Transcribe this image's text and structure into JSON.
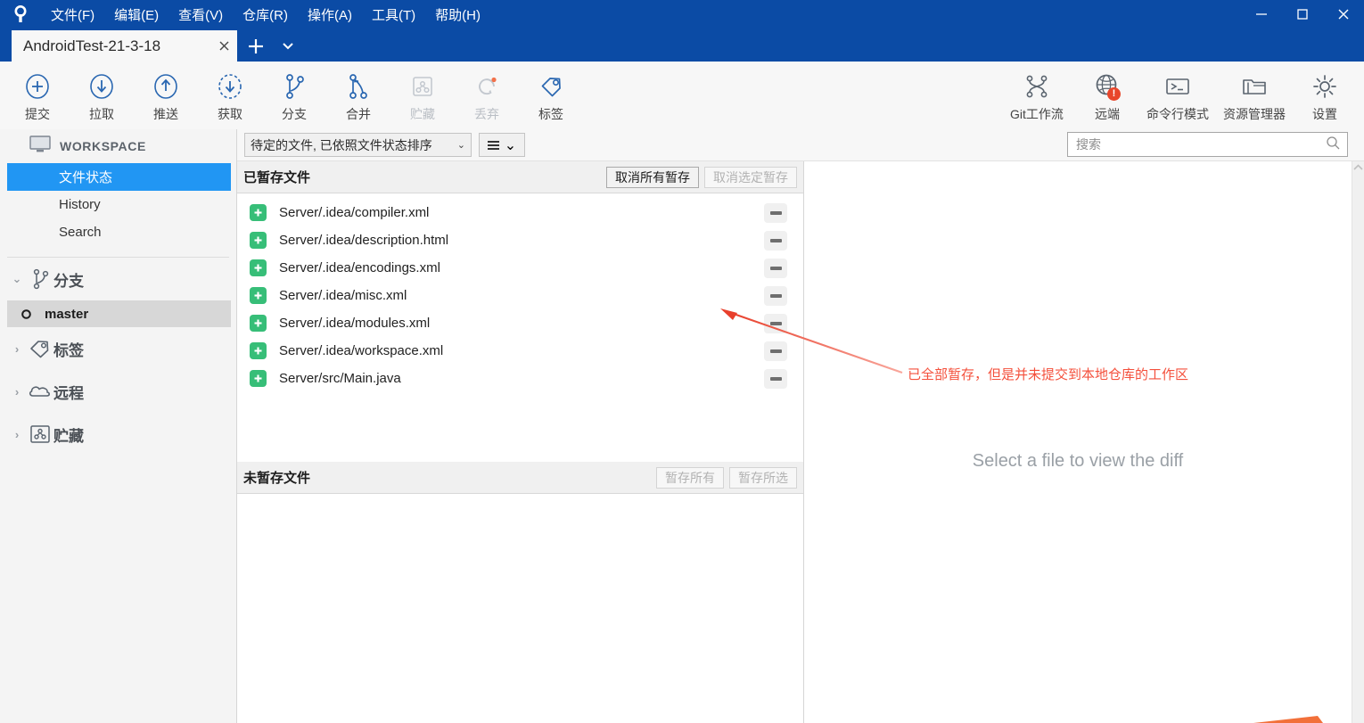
{
  "window": {
    "logo_icon": "sourcetree-logo-icon",
    "menus": [
      {
        "label": "文件(F)",
        "mnemonic": "F"
      },
      {
        "label": "编辑(E)",
        "mnemonic": "E"
      },
      {
        "label": "查看(V)",
        "mnemonic": "V"
      },
      {
        "label": "仓库(R)",
        "mnemonic": "R"
      },
      {
        "label": "操作(A)",
        "mnemonic": "A"
      },
      {
        "label": "工具(T)",
        "mnemonic": "T"
      },
      {
        "label": "帮助(H)",
        "mnemonic": "H"
      }
    ],
    "controls": {
      "minimize": "–",
      "maximize": "❐",
      "close": "✕"
    },
    "titlebar_color": "#0b4ba5"
  },
  "tabs": {
    "active": "AndroidTest-21-3-18",
    "close_label": "✕",
    "new_tab_label": "+",
    "dropdown_label": "▾",
    "menu_icon": "hamburger-menu-icon"
  },
  "toolbar": {
    "left": [
      {
        "label": "提交",
        "icon": "commit-icon",
        "disabled": false
      },
      {
        "label": "拉取",
        "icon": "pull-icon",
        "disabled": false
      },
      {
        "label": "推送",
        "icon": "push-icon",
        "disabled": false
      },
      {
        "label": "获取",
        "icon": "fetch-icon",
        "disabled": false
      },
      {
        "label": "分支",
        "icon": "branch-icon",
        "disabled": false
      },
      {
        "label": "合并",
        "icon": "merge-icon",
        "disabled": false
      },
      {
        "label": "贮藏",
        "icon": "stash-icon",
        "disabled": true
      },
      {
        "label": "丢弃",
        "icon": "discard-icon",
        "disabled": true
      },
      {
        "label": "标签",
        "icon": "tag-icon",
        "disabled": false
      }
    ],
    "right": [
      {
        "label": "Git工作流",
        "icon": "gitflow-icon",
        "badge": ""
      },
      {
        "label": "远端",
        "icon": "remote-globe-icon",
        "badge": "!"
      },
      {
        "label": "命令行模式",
        "icon": "terminal-icon",
        "badge": ""
      },
      {
        "label": "资源管理器",
        "icon": "explorer-folder-icon",
        "badge": ""
      },
      {
        "label": "设置",
        "icon": "settings-gear-icon",
        "badge": ""
      }
    ]
  },
  "sidebar": {
    "workspace_label": "WORKSPACE",
    "workspace_icon": "monitor-icon",
    "nav": [
      {
        "label": "文件状态",
        "selected": true
      },
      {
        "label": "History",
        "selected": false
      },
      {
        "label": "Search",
        "selected": false
      }
    ],
    "sections": [
      {
        "label": "分支",
        "icon": "branch-icon",
        "expanded": true,
        "chevron": "⌄"
      },
      {
        "label": "标签",
        "icon": "tag-icon",
        "expanded": false,
        "chevron": "›"
      },
      {
        "label": "远程",
        "icon": "cloud-icon",
        "expanded": false,
        "chevron": "›"
      },
      {
        "label": "贮藏",
        "icon": "stash-icon",
        "expanded": false,
        "chevron": "›"
      }
    ],
    "current_branch": "master",
    "branch_icon": "branch-dot-icon",
    "selected_color": "#2196f3"
  },
  "filterbar": {
    "sort_label": "待定的文件, 已依照文件状态排序",
    "sort_chevron": "⌄",
    "view_icon": "list-view-icon",
    "view_chevron": "⌄",
    "search_placeholder": "搜索",
    "search_value": "",
    "search_icon": "search-icon"
  },
  "staged": {
    "title": "已暂存文件",
    "buttons": [
      {
        "label": "取消所有暂存",
        "disabled": false
      },
      {
        "label": "取消选定暂存",
        "disabled": true
      }
    ],
    "files": [
      {
        "path": "Server/.idea/compiler.xml",
        "status": "added",
        "status_icon": "plus-icon",
        "action_icon": "minus-icon"
      },
      {
        "path": "Server/.idea/description.html",
        "status": "added",
        "status_icon": "plus-icon",
        "action_icon": "minus-icon"
      },
      {
        "path": "Server/.idea/encodings.xml",
        "status": "added",
        "status_icon": "plus-icon",
        "action_icon": "minus-icon"
      },
      {
        "path": "Server/.idea/misc.xml",
        "status": "added",
        "status_icon": "plus-icon",
        "action_icon": "minus-icon"
      },
      {
        "path": "Server/.idea/modules.xml",
        "status": "added",
        "status_icon": "plus-icon",
        "action_icon": "minus-icon"
      },
      {
        "path": "Server/.idea/workspace.xml",
        "status": "added",
        "status_icon": "plus-icon",
        "action_icon": "minus-icon"
      },
      {
        "path": "Server/src/Main.java",
        "status": "added",
        "status_icon": "plus-icon",
        "action_icon": "minus-icon"
      }
    ],
    "status_color": "#37be78"
  },
  "unstaged": {
    "title": "未暂存文件",
    "buttons": [
      {
        "label": "暂存所有",
        "disabled": true
      },
      {
        "label": "暂存所选",
        "disabled": true
      }
    ],
    "files": []
  },
  "diff": {
    "empty_message": "Select a file to view the diff",
    "scroll_up_icon": "chevron-up-icon"
  },
  "annotation": {
    "text": "已全部暂存，但是并未提交到本地仓库的工作区",
    "color": "#f4503c",
    "arrow_icon": "arrow-pointer-icon"
  }
}
